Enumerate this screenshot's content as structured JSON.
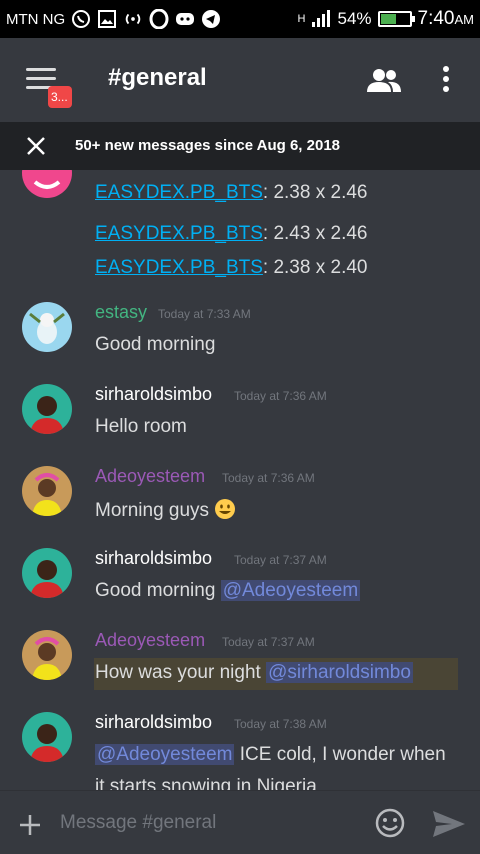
{
  "status_bar": {
    "carrier": "MTN NG",
    "network": "H",
    "battery": "54%",
    "battery_level": 0.54,
    "time": "7:40",
    "ampm": "AM"
  },
  "header": {
    "channel": "#general",
    "badge": "3..."
  },
  "new_messages": "50+ new messages since Aug 6, 2018",
  "messages": [
    {
      "lines": [
        {
          "link": "EASYDEX.PB_BTS",
          "rest": ": 2.38 x 2.46"
        },
        {
          "link": "EASYDEX.PB_BTS",
          "rest": ": 2.43 x 2.46"
        },
        {
          "link": "EASYDEX.PB_BTS",
          "rest": ": 2.38 x 2.40"
        }
      ]
    },
    {
      "author": "estasy",
      "author_color": "#43b581",
      "time": "Today at 7:33 AM",
      "text": "Good morning"
    },
    {
      "author": "sirharoldsimbo",
      "author_color": "#ffffff",
      "time": "Today at 7:36 AM",
      "text": "Hello room"
    },
    {
      "author": "Adeoyesteem",
      "author_color": "#9b59b6",
      "time": "Today at 7:36 AM",
      "text": "Morning guys"
    },
    {
      "author": "sirharoldsimbo",
      "author_color": "#ffffff",
      "time": "Today at 7:37 AM",
      "text": "Good morning ",
      "mention": "@Adeoyesteem"
    },
    {
      "author": "Adeoyesteem",
      "author_color": "#9b59b6",
      "time": "Today at 7:37 AM",
      "text": "How was your night ",
      "mention": "@sirharoldsimbo"
    },
    {
      "author": "sirharoldsimbo",
      "author_color": "#ffffff",
      "time": "Today at 7:38 AM",
      "mention": "@Adeoyesteem",
      "text": " ICE cold, I wonder when",
      "text2": "it starts snowing in Nigeria"
    }
  ],
  "composer": {
    "placeholder": "Message #general"
  },
  "colors": {
    "background": "#36393f",
    "bar": "#202225",
    "accent": "#7289da",
    "link": "#00b0f4",
    "badge": "#f04747"
  }
}
